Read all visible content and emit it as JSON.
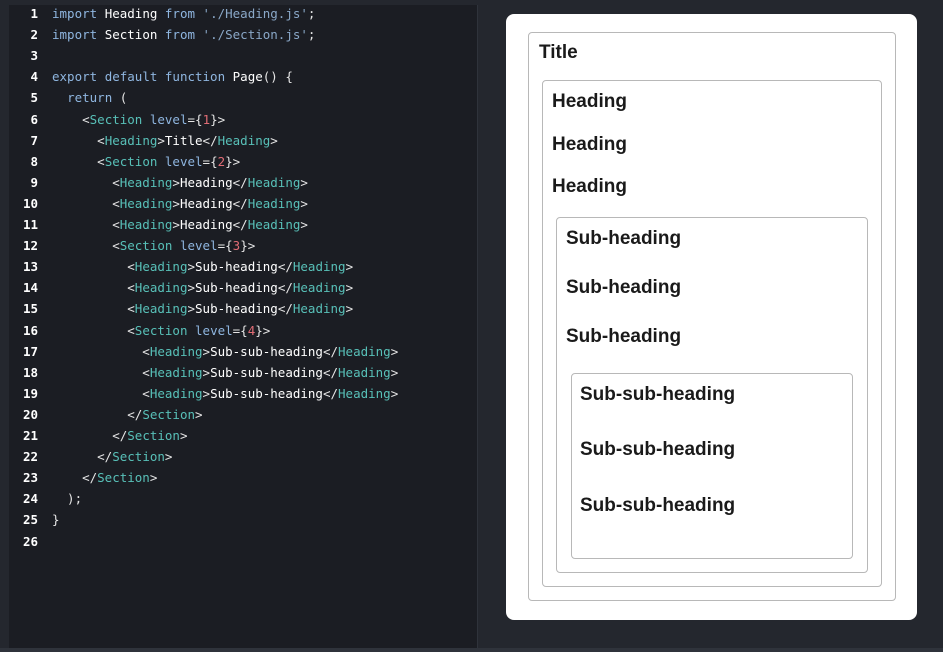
{
  "editor": {
    "lines": [
      {
        "n": "1",
        "tokens": [
          [
            "kw",
            "import"
          ],
          [
            "pun",
            " "
          ],
          [
            "id",
            "Heading"
          ],
          [
            "pun",
            " "
          ],
          [
            "kw",
            "from"
          ],
          [
            "pun",
            " "
          ],
          [
            "str",
            "'./Heading.js'"
          ],
          [
            "pun",
            ";"
          ]
        ]
      },
      {
        "n": "2",
        "tokens": [
          [
            "kw",
            "import"
          ],
          [
            "pun",
            " "
          ],
          [
            "id",
            "Section"
          ],
          [
            "pun",
            " "
          ],
          [
            "kw",
            "from"
          ],
          [
            "pun",
            " "
          ],
          [
            "str",
            "'./Section.js'"
          ],
          [
            "pun",
            ";"
          ]
        ]
      },
      {
        "n": "3",
        "tokens": []
      },
      {
        "n": "4",
        "tokens": [
          [
            "kw",
            "export"
          ],
          [
            "pun",
            " "
          ],
          [
            "kw",
            "default"
          ],
          [
            "pun",
            " "
          ],
          [
            "kw",
            "function"
          ],
          [
            "pun",
            " "
          ],
          [
            "id",
            "Page"
          ],
          [
            "pun",
            "() {"
          ]
        ]
      },
      {
        "n": "5",
        "tokens": [
          [
            "pun",
            "  "
          ],
          [
            "kw",
            "return"
          ],
          [
            "pun",
            " ("
          ]
        ]
      },
      {
        "n": "6",
        "tokens": [
          [
            "pun",
            "    <"
          ],
          [
            "tag",
            "Section"
          ],
          [
            "pun",
            " "
          ],
          [
            "attr",
            "level"
          ],
          [
            "pun",
            "={"
          ],
          [
            "num",
            "1"
          ],
          [
            "pun",
            "}>"
          ]
        ]
      },
      {
        "n": "7",
        "tokens": [
          [
            "pun",
            "      <"
          ],
          [
            "tag",
            "Heading"
          ],
          [
            "pun",
            ">"
          ],
          [
            "id",
            "Title"
          ],
          [
            "pun",
            "</"
          ],
          [
            "tag",
            "Heading"
          ],
          [
            "pun",
            ">"
          ]
        ]
      },
      {
        "n": "8",
        "tokens": [
          [
            "pun",
            "      <"
          ],
          [
            "tag",
            "Section"
          ],
          [
            "pun",
            " "
          ],
          [
            "attr",
            "level"
          ],
          [
            "pun",
            "={"
          ],
          [
            "num",
            "2"
          ],
          [
            "pun",
            "}>"
          ]
        ]
      },
      {
        "n": "9",
        "tokens": [
          [
            "pun",
            "        <"
          ],
          [
            "tag",
            "Heading"
          ],
          [
            "pun",
            ">"
          ],
          [
            "id",
            "Heading"
          ],
          [
            "pun",
            "</"
          ],
          [
            "tag",
            "Heading"
          ],
          [
            "pun",
            ">"
          ]
        ]
      },
      {
        "n": "10",
        "tokens": [
          [
            "pun",
            "        <"
          ],
          [
            "tag",
            "Heading"
          ],
          [
            "pun",
            ">"
          ],
          [
            "id",
            "Heading"
          ],
          [
            "pun",
            "</"
          ],
          [
            "tag",
            "Heading"
          ],
          [
            "pun",
            ">"
          ]
        ]
      },
      {
        "n": "11",
        "tokens": [
          [
            "pun",
            "        <"
          ],
          [
            "tag",
            "Heading"
          ],
          [
            "pun",
            ">"
          ],
          [
            "id",
            "Heading"
          ],
          [
            "pun",
            "</"
          ],
          [
            "tag",
            "Heading"
          ],
          [
            "pun",
            ">"
          ]
        ]
      },
      {
        "n": "12",
        "tokens": [
          [
            "pun",
            "        <"
          ],
          [
            "tag",
            "Section"
          ],
          [
            "pun",
            " "
          ],
          [
            "attr",
            "level"
          ],
          [
            "pun",
            "={"
          ],
          [
            "num",
            "3"
          ],
          [
            "pun",
            "}>"
          ]
        ]
      },
      {
        "n": "13",
        "tokens": [
          [
            "pun",
            "          <"
          ],
          [
            "tag",
            "Heading"
          ],
          [
            "pun",
            ">"
          ],
          [
            "id",
            "Sub-heading"
          ],
          [
            "pun",
            "</"
          ],
          [
            "tag",
            "Heading"
          ],
          [
            "pun",
            ">"
          ]
        ]
      },
      {
        "n": "14",
        "tokens": [
          [
            "pun",
            "          <"
          ],
          [
            "tag",
            "Heading"
          ],
          [
            "pun",
            ">"
          ],
          [
            "id",
            "Sub-heading"
          ],
          [
            "pun",
            "</"
          ],
          [
            "tag",
            "Heading"
          ],
          [
            "pun",
            ">"
          ]
        ]
      },
      {
        "n": "15",
        "tokens": [
          [
            "pun",
            "          <"
          ],
          [
            "tag",
            "Heading"
          ],
          [
            "pun",
            ">"
          ],
          [
            "id",
            "Sub-heading"
          ],
          [
            "pun",
            "</"
          ],
          [
            "tag",
            "Heading"
          ],
          [
            "pun",
            ">"
          ]
        ]
      },
      {
        "n": "16",
        "tokens": [
          [
            "pun",
            "          <"
          ],
          [
            "tag",
            "Section"
          ],
          [
            "pun",
            " "
          ],
          [
            "attr",
            "level"
          ],
          [
            "pun",
            "={"
          ],
          [
            "num",
            "4"
          ],
          [
            "pun",
            "}>"
          ]
        ]
      },
      {
        "n": "17",
        "tokens": [
          [
            "pun",
            "            <"
          ],
          [
            "tag",
            "Heading"
          ],
          [
            "pun",
            ">"
          ],
          [
            "id",
            "Sub-sub-heading"
          ],
          [
            "pun",
            "</"
          ],
          [
            "tag",
            "Heading"
          ],
          [
            "pun",
            ">"
          ]
        ]
      },
      {
        "n": "18",
        "tokens": [
          [
            "pun",
            "            <"
          ],
          [
            "tag",
            "Heading"
          ],
          [
            "pun",
            ">"
          ],
          [
            "id",
            "Sub-sub-heading"
          ],
          [
            "pun",
            "</"
          ],
          [
            "tag",
            "Heading"
          ],
          [
            "pun",
            ">"
          ]
        ]
      },
      {
        "n": "19",
        "tokens": [
          [
            "pun",
            "            <"
          ],
          [
            "tag",
            "Heading"
          ],
          [
            "pun",
            ">"
          ],
          [
            "id",
            "Sub-sub-heading"
          ],
          [
            "pun",
            "</"
          ],
          [
            "tag",
            "Heading"
          ],
          [
            "pun",
            ">"
          ]
        ]
      },
      {
        "n": "20",
        "tokens": [
          [
            "pun",
            "          </"
          ],
          [
            "tag",
            "Section"
          ],
          [
            "pun",
            ">"
          ]
        ]
      },
      {
        "n": "21",
        "tokens": [
          [
            "pun",
            "        </"
          ],
          [
            "tag",
            "Section"
          ],
          [
            "pun",
            ">"
          ]
        ]
      },
      {
        "n": "22",
        "tokens": [
          [
            "pun",
            "      </"
          ],
          [
            "tag",
            "Section"
          ],
          [
            "pun",
            ">"
          ]
        ]
      },
      {
        "n": "23",
        "tokens": [
          [
            "pun",
            "    </"
          ],
          [
            "tag",
            "Section"
          ],
          [
            "pun",
            ">"
          ]
        ]
      },
      {
        "n": "24",
        "tokens": [
          [
            "pun",
            "  );"
          ]
        ]
      },
      {
        "n": "25",
        "tokens": [
          [
            "pun",
            "}"
          ]
        ]
      },
      {
        "n": "26",
        "tokens": []
      }
    ]
  },
  "preview": {
    "title": "Title",
    "level2": [
      "Heading",
      "Heading",
      "Heading"
    ],
    "level3": [
      "Sub-heading",
      "Sub-heading",
      "Sub-heading"
    ],
    "level4": [
      "Sub-sub-heading",
      "Sub-sub-heading",
      "Sub-sub-heading"
    ]
  },
  "colors": {
    "editor_bg": "#1b1d23",
    "keyword": "#8fb6e0",
    "tag": "#58c0b8",
    "number": "#e06c75",
    "preview_bg": "#ffffff"
  }
}
